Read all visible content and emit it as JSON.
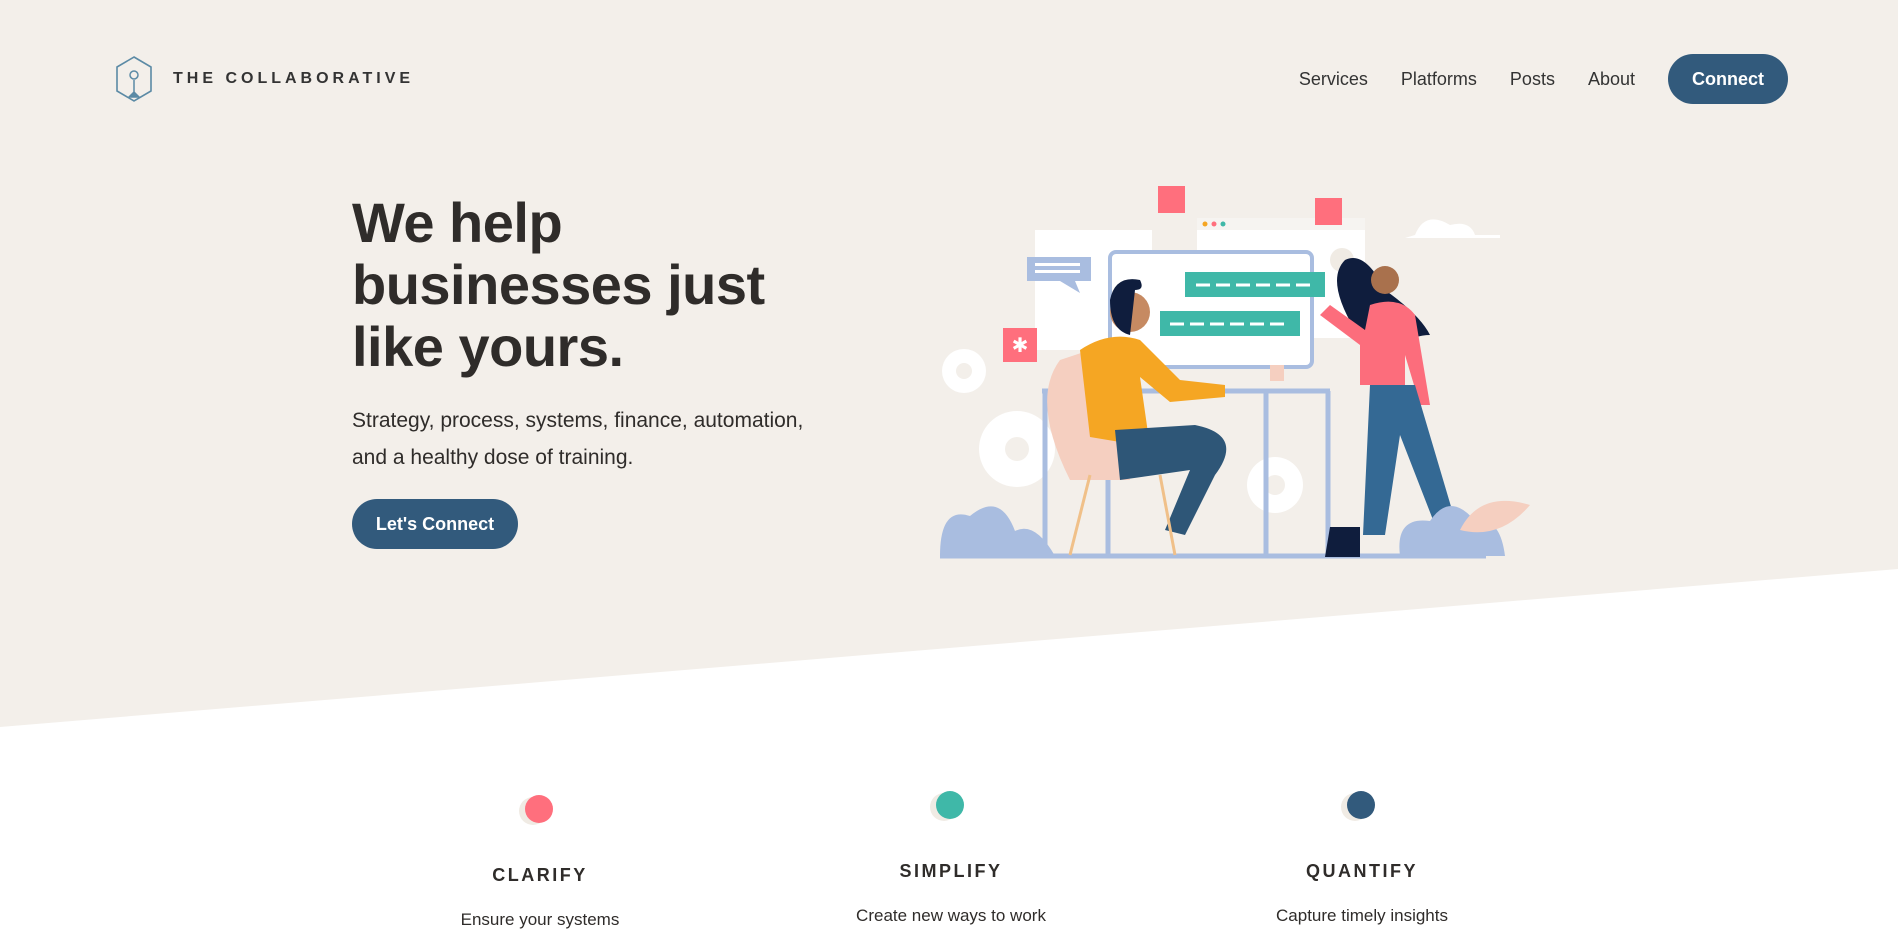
{
  "brand": {
    "name": "THE COLLABORATIVE",
    "icon": "hexagon-lightbulb-logo"
  },
  "nav": {
    "items": [
      {
        "label": "Services"
      },
      {
        "label": "Platforms"
      },
      {
        "label": "Posts"
      },
      {
        "label": "About"
      }
    ],
    "cta": "Connect"
  },
  "hero": {
    "title_lines": [
      "We help",
      "businesses just",
      "like yours."
    ],
    "subtitle_lines": [
      "Strategy, process, systems, finance, automation,",
      "and a healthy dose of training."
    ],
    "cta": "Let's Connect"
  },
  "features": [
    {
      "title": "CLARIFY",
      "text": "Ensure your systems",
      "color": "#ff6f7d"
    },
    {
      "title": "SIMPLIFY",
      "text": "Create new ways to work",
      "color": "#3fb8a8"
    },
    {
      "title": "QUANTIFY",
      "text": "Capture timely insights",
      "color": "#325a7c"
    }
  ],
  "colors": {
    "background": "#f3efea",
    "accent": "#325a7c",
    "text": "#2f2c2a"
  }
}
